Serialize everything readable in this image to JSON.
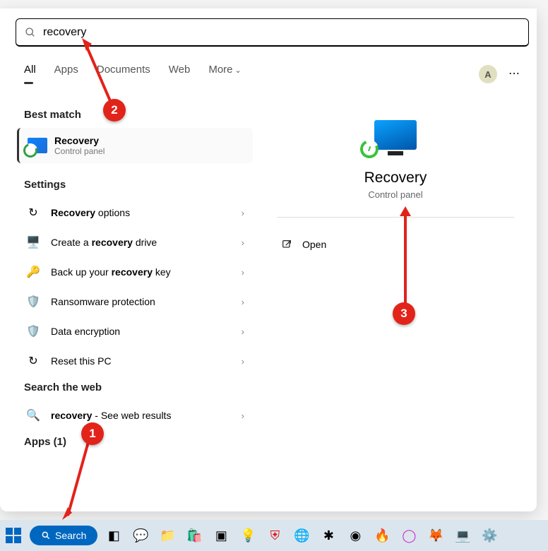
{
  "search": {
    "value": "recovery"
  },
  "tabs": {
    "items": [
      "All",
      "Apps",
      "Documents",
      "Web",
      "More"
    ],
    "active": 0
  },
  "avatar": "A",
  "left": {
    "best_h": "Best match",
    "best": {
      "title": "Recovery",
      "sub": "Control panel"
    },
    "settings_h": "Settings",
    "settings": [
      {
        "html": "<b>Recovery</b> options"
      },
      {
        "html": "Create a <b>recovery</b> drive"
      },
      {
        "html": "Back up your <b>recovery</b> key"
      },
      {
        "html": "Ransomware protection"
      },
      {
        "html": "Data encryption"
      },
      {
        "html": "Reset this PC"
      }
    ],
    "web_h": "Search the web",
    "web": {
      "html": "<b>recovery</b> - See web results"
    },
    "apps_h": "Apps (1)"
  },
  "right": {
    "title": "Recovery",
    "sub": "Control panel",
    "open": "Open"
  },
  "taskbar": {
    "search": "Search"
  },
  "badges": {
    "b1": "1",
    "b2": "2",
    "b3": "3"
  }
}
